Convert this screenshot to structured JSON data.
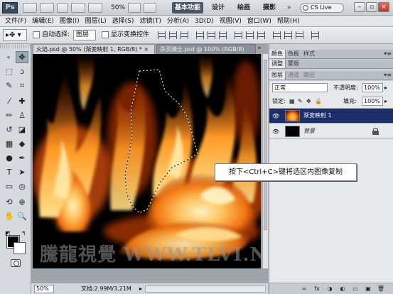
{
  "app": {
    "logo": "Ps",
    "zoom": "50%",
    "cs_live": "CS Live"
  },
  "workspaces": [
    {
      "label": "基本功能"
    },
    {
      "label": "设计"
    },
    {
      "label": "绘画"
    },
    {
      "label": "摄影"
    }
  ],
  "workspace_more": "»",
  "menubar": [
    "文件(F)",
    "编辑(E)",
    "图像(I)",
    "图层(L)",
    "选择(S)",
    "滤镜(T)",
    "分析(A)",
    "3D(D)",
    "视图(V)",
    "窗口(W)",
    "帮助(H)"
  ],
  "options": {
    "auto_select_label": "自动选择:",
    "auto_select_value": "图层",
    "show_transform_label": "显示变换控件"
  },
  "tabs": {
    "active": "火焰.psd @ 50% (渐变映射 1, RGB/8) *",
    "inactive": "杀灵骑士.psd @ 100% (RGB/8)",
    "close": "×",
    "scroll": "»"
  },
  "canvas": {
    "watermark": "騰龍視覺 WWW.TLVI.NET",
    "callout": "按下<Ctrl+C>键将选区内图像复制"
  },
  "status": {
    "zoom": "50%",
    "doc": "文档:2.99M/3.21M",
    "arrow": "▸"
  },
  "panels": {
    "top_tabs": [
      "颜色",
      "色板",
      "样式"
    ],
    "mid_tabs": [
      "调整",
      "蒙版"
    ],
    "layer_tabs": [
      "图层",
      "通道",
      "路径"
    ],
    "blend_mode": "正常",
    "opacity_label": "不透明度:",
    "opacity_value": "100%",
    "lock_label": "锁定:",
    "fill_label": "填充:",
    "fill_value": "100%",
    "menu_glyph": "▾≡"
  },
  "layers": [
    {
      "name": "渐变映射 1",
      "selected": true
    },
    {
      "name": "背景",
      "selected": false
    }
  ],
  "footer_icons": [
    "∞",
    "fx",
    "◑",
    "◐",
    "▭",
    "▣",
    "🗑"
  ],
  "colors": {
    "accent": "#1d2f6b",
    "fire_core": "#ffd27a",
    "fire_mid": "#ff8a1e",
    "fire_edge": "#b83a05"
  }
}
